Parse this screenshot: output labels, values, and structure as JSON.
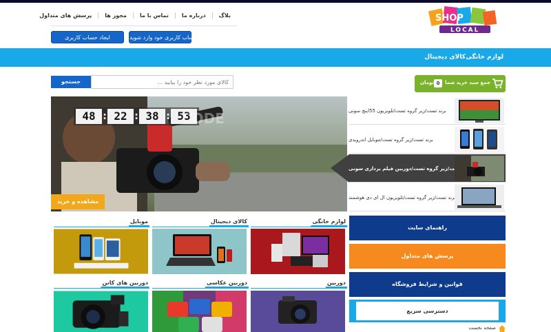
{
  "logo": {
    "word_top": "SHOP",
    "word_bottom": "LOCAL"
  },
  "header": {
    "links": [
      "بلاگ",
      "درباره ما",
      "تماس با ما",
      "مجوز ها",
      "پرسش های متداول"
    ],
    "login_label": "به حساب کاربری خود وارد شوید.",
    "register_label": "ایجاد حساب کاربری"
  },
  "nav": {
    "items": [
      "لوازم خانگی",
      "کالای دیجیتال"
    ]
  },
  "search": {
    "placeholder": "کالای مورد نظر خود را بیابید ...",
    "button_label": "جستجو"
  },
  "cart": {
    "label": "جمع سبد خرید شما",
    "count": "0",
    "unit": "تومان"
  },
  "slider": {
    "countdown": [
      "48",
      "22",
      "38",
      "53"
    ],
    "watermark": "CODE",
    "button_label": "مشاهده و خرید",
    "items": [
      {
        "text": "برند تست/زیر گروه تست/تلویزیون 55اینچ سونی"
      },
      {
        "text": "برند تست/زیر گروه تست/موبایل اندرویدی"
      },
      {
        "text": "برند تست/زیر گروه تست/دوربین فیلم برداری سونی"
      },
      {
        "text": "برند تست/زیر گروه تست/تلویزیون ال ای دی هوشمند"
      }
    ],
    "active_index": 2
  },
  "categories": [
    {
      "title": "لوازم خانگی"
    },
    {
      "title": "کالای دیجیتال"
    },
    {
      "title": "موبایل"
    },
    {
      "title": "دوربین"
    },
    {
      "title": "دوربین عکاسی"
    },
    {
      "title": "دوربین های کانن"
    }
  ],
  "sidebar": {
    "buttons": [
      {
        "label": "راهنمای سایت",
        "color": "#0e3b8c"
      },
      {
        "label": "پرسش های متداول",
        "color": "#f68a1e"
      },
      {
        "label": "قوانین و شرایط فروشگاه",
        "color": "#0e3b8c"
      }
    ],
    "quick_access": "دسترسی سریع",
    "home_link": "صفحه نخست"
  },
  "colors": {
    "accent": "#1aa9e8",
    "button_blue": "#1566c8",
    "cart_green": "#7ab32b",
    "orange": "#f68a1e",
    "navy": "#0e3b8c"
  }
}
